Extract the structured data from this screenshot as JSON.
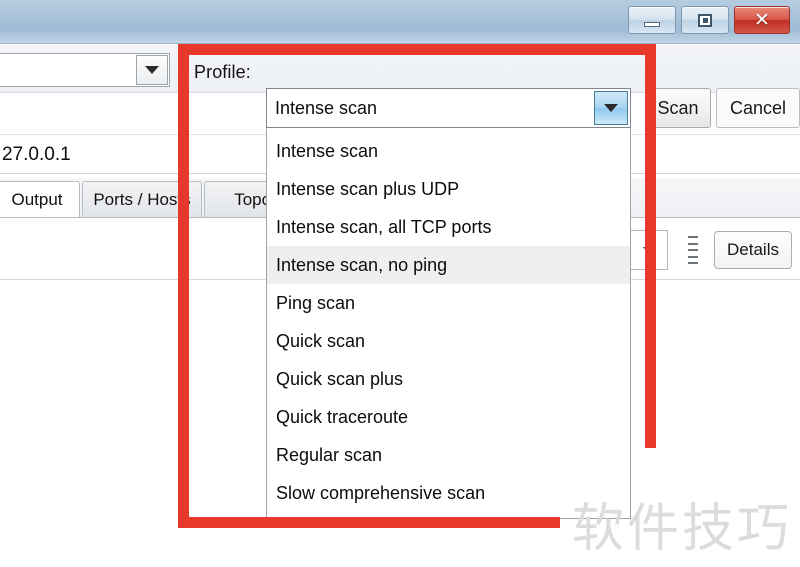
{
  "window": {
    "controls": [
      {
        "name": "minimize",
        "glyph": "minimize-icon"
      },
      {
        "name": "maximize",
        "glyph": "maximize-icon"
      },
      {
        "name": "close",
        "glyph": "close-icon",
        "label": "✕",
        "color": "#c0392b"
      }
    ]
  },
  "toolbar": {
    "target_placeholder": "",
    "target_value": "",
    "profile_label": "Profile:",
    "profile_value": "Intense scan",
    "scan_label": "Scan",
    "cancel_label": "Cancel"
  },
  "command_row": {
    "value": "27.0.0.1"
  },
  "tabs": [
    {
      "label": "Output",
      "active": true
    },
    {
      "label": "Ports / Hosts",
      "active": false
    },
    {
      "label": "Topolog",
      "active": false
    }
  ],
  "content_header": {
    "details_label": "Details",
    "filter_icon": "chevron-down-icon",
    "grip_icon": "grip-handle-icon"
  },
  "profile_dropdown": {
    "open": true,
    "highlighted_index": 3,
    "items": [
      "Intense scan",
      "Intense scan plus UDP",
      "Intense scan, all TCP ports",
      "Intense scan, no ping",
      "Ping scan",
      "Quick scan",
      "Quick scan plus",
      "Quick traceroute",
      "Regular scan",
      "Slow comprehensive scan"
    ]
  },
  "annotation": {
    "color": "#e8382b",
    "shape": "rectangle"
  },
  "watermark": {
    "text": "软件技巧",
    "color": "#dcdcdc"
  }
}
